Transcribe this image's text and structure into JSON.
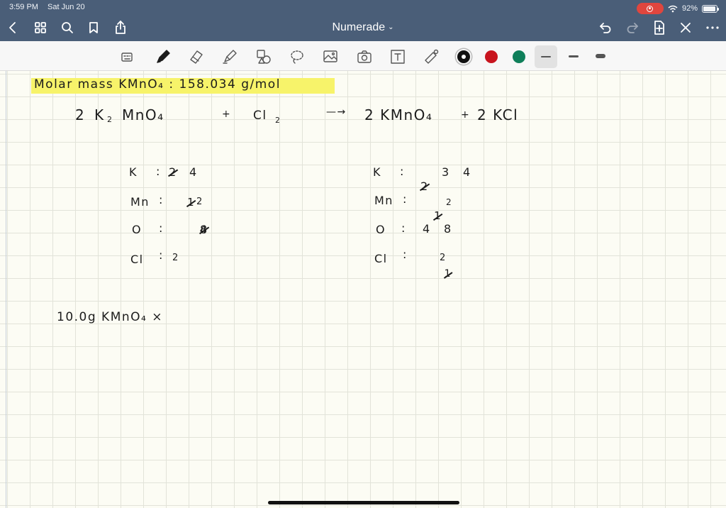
{
  "status": {
    "time": "3:59 PM",
    "date": "Sat Jun 20",
    "battery": "92%",
    "battery_level": 0.92
  },
  "nav": {
    "title": "Numerade"
  },
  "toolbar": {
    "icons": [
      "keyboard-icon",
      "pen-icon",
      "eraser-icon",
      "highlighter-icon",
      "shapes-icon",
      "lasso-icon",
      "image-icon",
      "camera-icon",
      "text-box-icon",
      "laser-pointer-icon"
    ],
    "colors": [
      "#111111",
      "#c8141e",
      "#0f7f5a"
    ],
    "selected_color": "#111111"
  },
  "note": {
    "molar_mass": "Molar mass KMnO₄ : 158.034 g/mol",
    "equation": {
      "r1_coef": "2",
      "r1_a": "K",
      "r1_a_sub": "2",
      "r1_b": "MnO₄",
      "plus1": "+",
      "r2": "Cl",
      "r2_sub": "2",
      "arrow": "—→",
      "p1": "2 KMnO₄",
      "plus2": "+",
      "p2": "2 KCl"
    },
    "left": [
      {
        "el": "K",
        "struck": "2",
        "val": "4"
      },
      {
        "el": "Mn",
        "struck": "1",
        "val": "2"
      },
      {
        "el": "O",
        "struck": "4",
        "val": "8"
      },
      {
        "el": "Cl",
        "struck": "",
        "val": "2"
      }
    ],
    "right": [
      {
        "el": "K",
        "struck": "2",
        "mid": "3",
        "val": "4"
      },
      {
        "el": "Mn",
        "struck": "1",
        "val": "2"
      },
      {
        "el": "O",
        "struck": "",
        "mid": "4",
        "val": "8"
      },
      {
        "el": "Cl",
        "struck": "1",
        "val": "2"
      }
    ],
    "calc": "10.0g KMnO₄ ×"
  }
}
